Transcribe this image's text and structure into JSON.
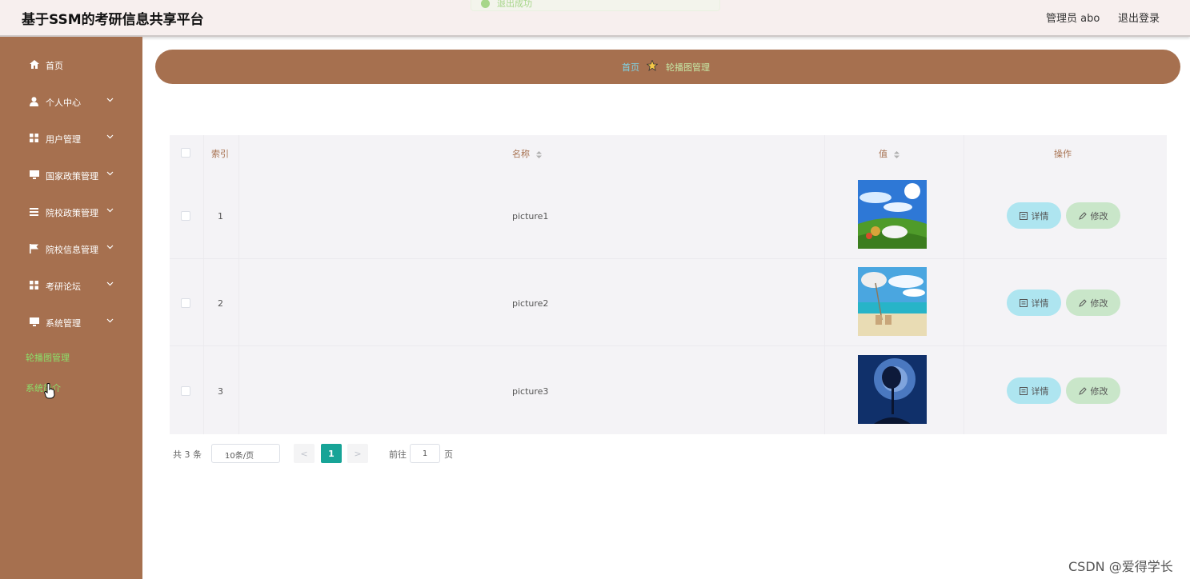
{
  "header": {
    "title": "基于SSM的考研信息共享平台",
    "toast": "退出成功",
    "user": "管理员 abo",
    "logout": "退出登录"
  },
  "sidebar": {
    "items": [
      {
        "label": "首页",
        "icon": "home-icon",
        "has_children": false
      },
      {
        "label": "个人中心",
        "icon": "user-icon",
        "has_children": true
      },
      {
        "label": "用户管理",
        "icon": "grid-icon",
        "has_children": true
      },
      {
        "label": "国家政策管理",
        "icon": "monitor-icon",
        "has_children": true
      },
      {
        "label": "院校政策管理",
        "icon": "list-icon",
        "has_children": true
      },
      {
        "label": "院校信息管理",
        "icon": "flag-icon",
        "has_children": true
      },
      {
        "label": "考研论坛",
        "icon": "grid-icon",
        "has_children": true
      },
      {
        "label": "系统管理",
        "icon": "monitor-icon",
        "has_children": true
      }
    ],
    "sub_items": [
      "轮播图管理",
      "系统简介"
    ]
  },
  "breadcrumb": {
    "home": "首页",
    "current": "轮播图管理"
  },
  "table": {
    "columns": [
      "索引",
      "名称",
      "值",
      "操作"
    ],
    "rows": [
      {
        "index": "1",
        "name": "picture1",
        "image": "meadow-picnic"
      },
      {
        "index": "2",
        "name": "picture2",
        "image": "beach-chairs"
      },
      {
        "index": "3",
        "name": "picture3",
        "image": "night-tree"
      }
    ],
    "detail_label": "详情",
    "edit_label": "修改"
  },
  "pagination": {
    "total": "共 3 条",
    "page_size": "10条/页",
    "prev": "<",
    "next": ">",
    "current_page": "1",
    "goto_label": "前往",
    "goto_value": "1",
    "goto_suffix": "页"
  },
  "watermark": "CSDN @爱得学长",
  "colors": {
    "brand": "#a6704f",
    "active_page": "#17a497",
    "detail_button": "#aee5f0",
    "edit_button": "#c9e6c9",
    "sub_item": "#8be06a"
  }
}
